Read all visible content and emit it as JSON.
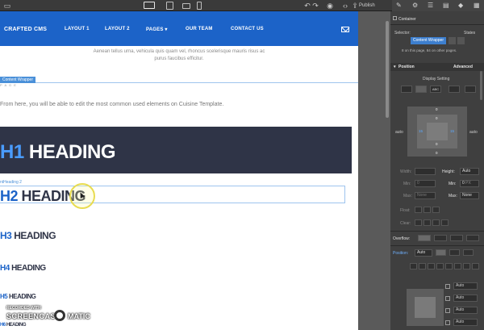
{
  "topbar": {
    "publish_label": "Publish",
    "undo_icon": "undo-icon",
    "redo_icon": "redo-icon",
    "code_icon": "code-icon",
    "share_icon": "share-icon"
  },
  "site": {
    "brand": "CRAFTED CMS",
    "nav": [
      "LAYOUT 1",
      "LAYOUT 2",
      "PAGES ▾",
      "OUR TEAM",
      "CONTACT US"
    ],
    "lorem_line1": "Aenean tellus urna, vehicula quis quam vel, rhoncus scelerisque mauris risus ac",
    "lorem_line2": "purus faucibus efficitur.",
    "wrapper_tag": "Content Wrapper",
    "small_tag": "P A G E",
    "intro": "From here, you will be able to edit the most common used elements on Cuisine Template.",
    "h2_label": "ntHeading 2",
    "headings": [
      {
        "tag": "H1",
        "text": "HEADING"
      },
      {
        "tag": "H2",
        "text": "HEADING"
      },
      {
        "tag": "H3",
        "text": "HEADING"
      },
      {
        "tag": "H4",
        "text": "HEADING"
      },
      {
        "tag": "H5",
        "text": "HEADING"
      },
      {
        "tag": "H6",
        "text": "HEADING"
      }
    ]
  },
  "watermark": {
    "line1": "RECORDED WITH",
    "line2": "SCREENCAST",
    "line3": "MATIC"
  },
  "panel": {
    "title": "Container",
    "selector_label": "Selector:",
    "states_label": "States",
    "selector_chip": "Content Wrapper",
    "selector_info": "8 on this page, 84 on other pages.",
    "position_section": "Position",
    "advanced_label": "Advanced",
    "display_setting": "Display Setting",
    "display_buttons": [
      "",
      "",
      "ABC",
      "",
      ""
    ],
    "box": {
      "margin_top": "0",
      "padding_top": "0",
      "padding_left": "15",
      "padding_right": "15",
      "padding_bottom": "0",
      "margin_bottom": "0",
      "auto_left": "auto",
      "auto_right": "auto"
    },
    "fields": {
      "width_label": "Width:",
      "width_value": "Auto",
      "height_label": "Height:",
      "height_value": "Auto",
      "min_label": "Min:",
      "min_value": "0",
      "min2_label": "Min:",
      "min2_value": "0",
      "min2_unit": "PX",
      "max_label": "Max:",
      "max_value": "None",
      "max2_label": "Max:",
      "max2_value": "None",
      "float_label": "Float:",
      "clear_label": "Clear:",
      "overflow_label": "Overflow:",
      "position_label": "Position:",
      "position_value": "Auto"
    },
    "pos_fields": [
      "Auto",
      "Auto",
      "Auto",
      "Auto"
    ],
    "accent": "#3d7fcf"
  }
}
